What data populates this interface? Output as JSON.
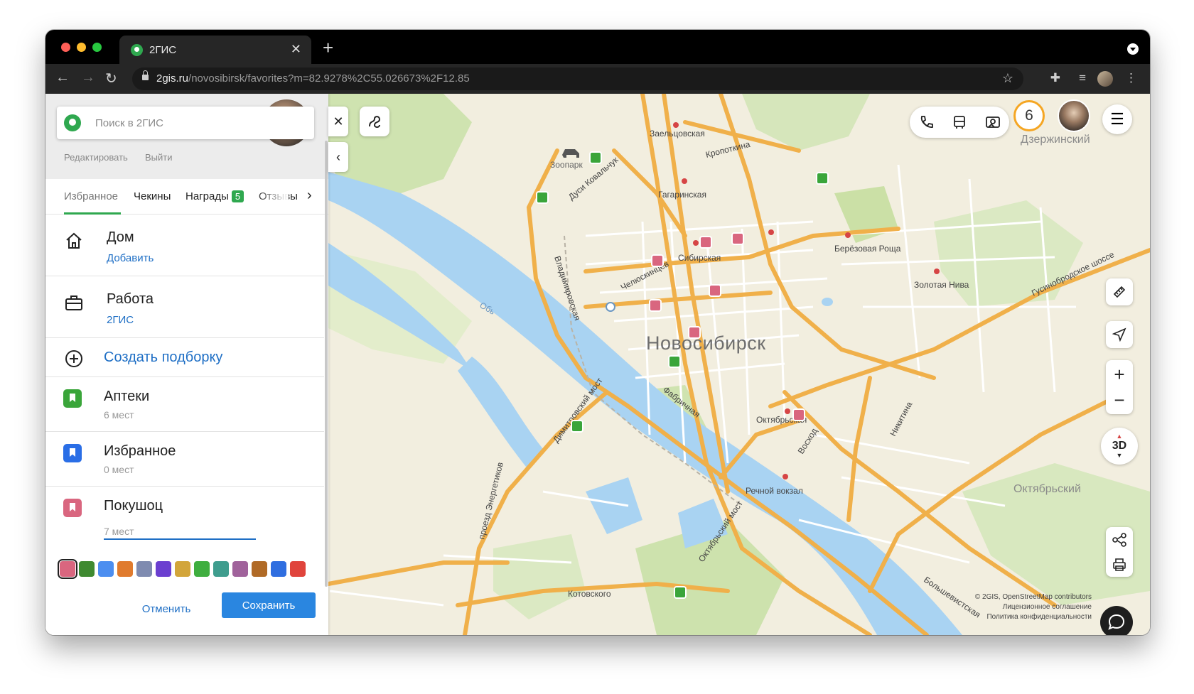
{
  "browser": {
    "tab_title": "2ГИС",
    "url_host": "2gis.ru",
    "url_path": "/novosibirsk/favorites?m=82.9278%2C55.026673%2F12.85"
  },
  "sidebar": {
    "search_placeholder": "Поиск в 2ГИС",
    "edit_link": "Редактировать",
    "logout_link": "Выйти",
    "tabs": [
      {
        "label": "Избранное"
      },
      {
        "label": "Чекины"
      },
      {
        "label": "Награды",
        "badge": "5"
      },
      {
        "label": "Отзывы"
      }
    ],
    "home": {
      "title": "Дом",
      "action": "Добавить"
    },
    "work": {
      "title": "Работа",
      "value": "2ГИС"
    },
    "create_collection": "Создать подборку",
    "collections": [
      {
        "name": "Аптеки",
        "count": "6 мест",
        "color": "#3aa53a"
      },
      {
        "name": "Избранное",
        "count": "0 мест",
        "color": "#2a6ee6"
      },
      {
        "name": "Покушоц",
        "count": "7 мест",
        "color": "#d9667f"
      }
    ],
    "palette": [
      "#d9667f",
      "#3f8a31",
      "#4c8ef0",
      "#e07b2e",
      "#7f8bb0",
      "#6b3fd0",
      "#d2a53a",
      "#3fae3f",
      "#3f9d8e",
      "#a0629b",
      "#b06a26",
      "#2f6ee0",
      "#e0443c"
    ],
    "cancel": "Отменить",
    "save": "Сохранить"
  },
  "map": {
    "city": "Новосибирск",
    "districts": [
      "Дзержинский",
      "Октябрьский"
    ],
    "streets": [
      "Заельцовская",
      "Кропоткина",
      "Гагаринская",
      "Зоопарк",
      "Дуси Ковальчук",
      "Сибирская",
      "Челюскинцев",
      "Берёзовая Роща",
      "Золотая Нива",
      "Гусинобродское шоссе",
      "Владимировская",
      "Обь",
      "Фабричная",
      "Димитровский мост",
      "Октябрьская",
      "Восход",
      "Никитина",
      "Речной вокзал",
      "Октябрьский мост",
      "проезд Энергетиков",
      "Котовского",
      "Большевистская"
    ],
    "notifications": "6",
    "zoom_3d": "3D",
    "copyright": [
      "© 2GIS, OpenStreetMap contributors",
      "Лицензионное соглашение",
      "Политика конфиденциальности"
    ]
  }
}
